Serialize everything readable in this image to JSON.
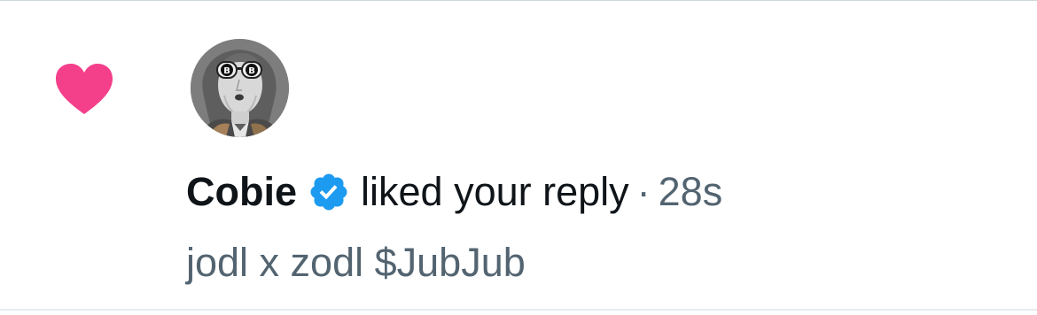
{
  "notification": {
    "type_icon": "heart-icon",
    "avatar_icon": "avatar",
    "user_name": "Cobie",
    "verified_icon": "verified-badge-icon",
    "action": "liked your reply",
    "separator": "·",
    "time": "28s",
    "reply_text": "jodl x zodl $JubJub"
  },
  "colors": {
    "heart": "#f91880",
    "verified": "#1d9bf0",
    "primary_text": "#0f1419",
    "secondary_text": "#536471"
  }
}
